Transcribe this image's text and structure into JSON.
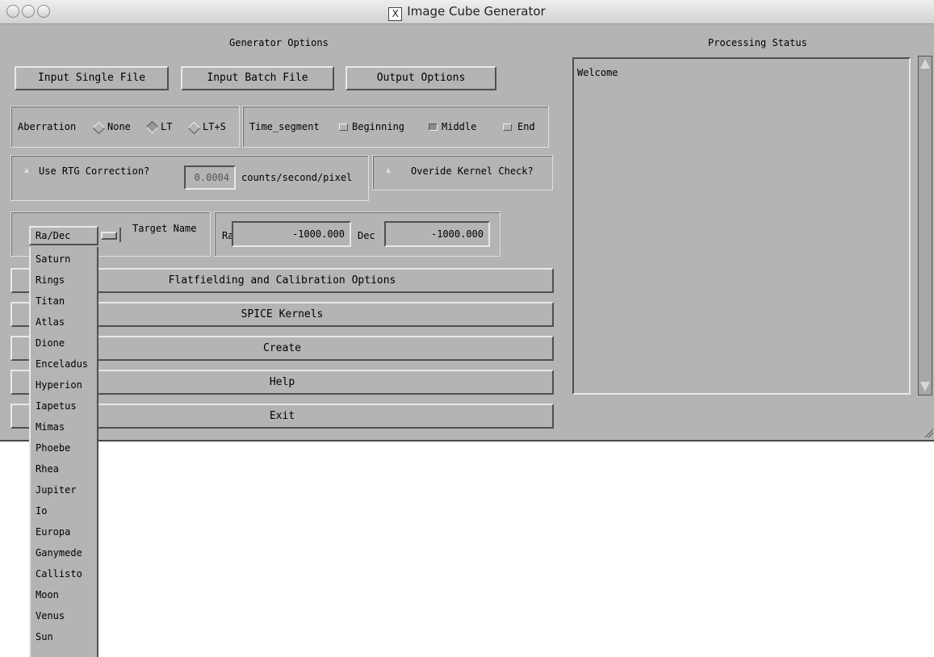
{
  "window": {
    "title": "Image Cube Generator",
    "x_icon_label": "X"
  },
  "generator_options": {
    "heading": "Generator Options",
    "input_single_file": "Input Single File",
    "input_batch_file": "Input Batch File",
    "output_options": "Output Options",
    "aberration": {
      "label": "Aberration",
      "options": [
        "None",
        "LT",
        "LT+S"
      ],
      "selected": "LT"
    },
    "time_segment": {
      "label": "Time_segment",
      "options": [
        "Beginning",
        "Middle",
        "End"
      ],
      "selected": "Middle"
    },
    "rtg": {
      "label": "Use RTG Correction?",
      "value": "0.0004",
      "units": "counts/second/pixel"
    },
    "override_kernel_label": "Overide Kernel Check?",
    "target": {
      "selected": "Ra/Dec",
      "name_label": "Target Name",
      "ra_label": "Ra",
      "ra_value": "-1000.000",
      "dec_label": "Dec",
      "dec_value": "-1000.000",
      "options": [
        "Saturn",
        "Rings",
        "Titan",
        "Atlas",
        "Dione",
        "Enceladus",
        "Hyperion",
        "Iapetus",
        "Mimas",
        "Phoebe",
        "Rhea",
        "Jupiter",
        "Io",
        "Europa",
        "Ganymede",
        "Callisto",
        "Moon",
        "Venus",
        "Sun"
      ]
    },
    "buttons": {
      "flatfielding": "Flatfielding and Calibration Options",
      "spice": "SPICE Kernels",
      "create": "Create",
      "help": "Help",
      "exit": "Exit"
    }
  },
  "processing_status": {
    "heading": "Processing Status",
    "text": "Welcome"
  }
}
